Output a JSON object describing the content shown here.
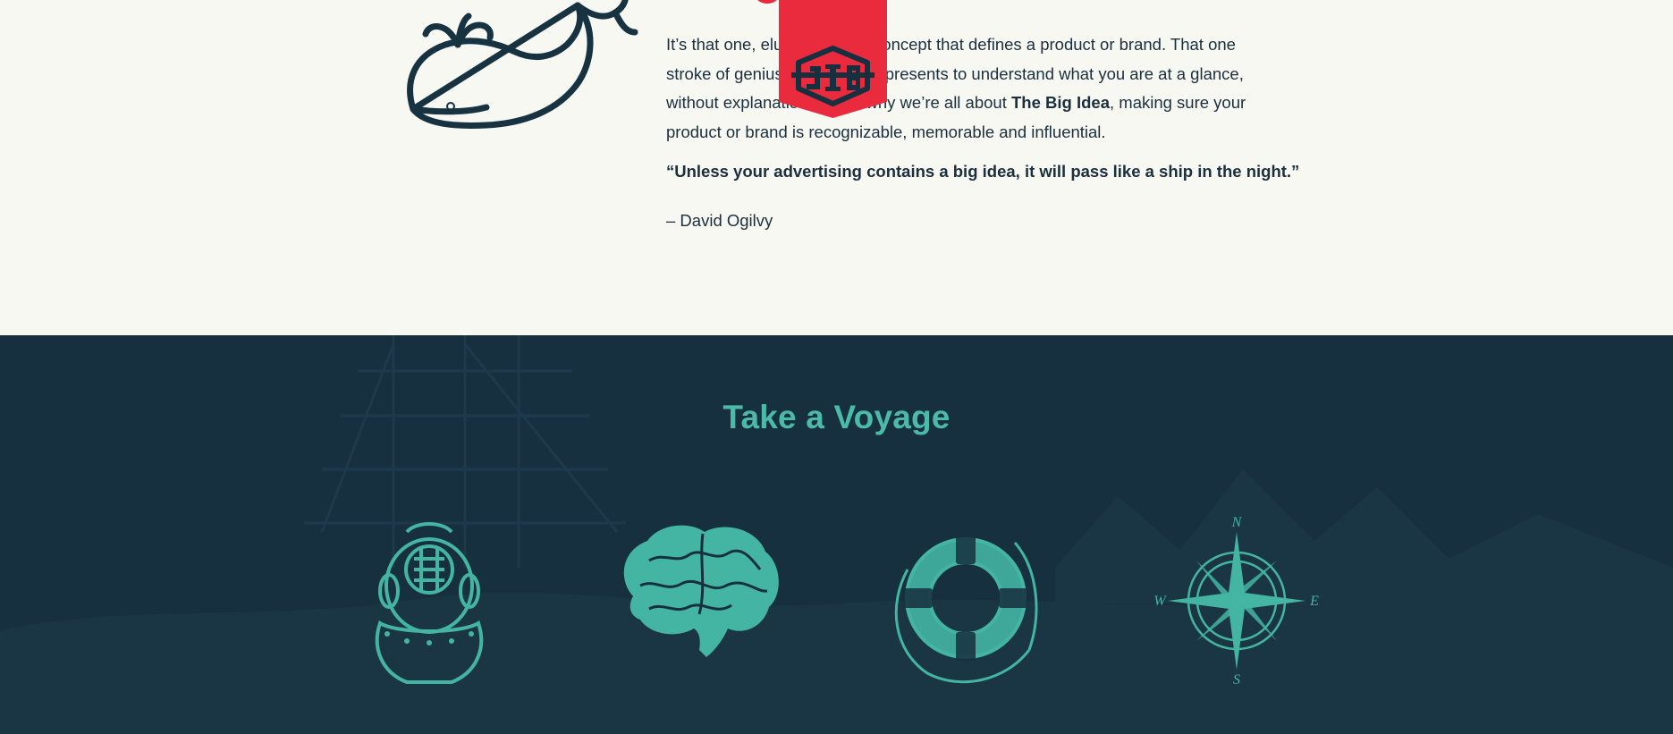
{
  "intro": {
    "p1_a": "It’s that one, elusive, simple concept that defines a product or brand. That one stroke of genius that instantly presents to understand what you are at a glance, without explanation. That’s why we’re all about ",
    "p1_bold": "The Big Idea",
    "p1_b": ", making sure your product or brand is recognizable, memorable and influential.",
    "quote": "“Unless your advertising contains a big idea, it will pass like a ship in the night.”",
    "attribution": "– David Ogilvy"
  },
  "badge": {
    "text": "JIB",
    "color": "#ea2a3d"
  },
  "voyage": {
    "title": "Take a Voyage",
    "icons": [
      {
        "name": "diving-helmet-icon"
      },
      {
        "name": "brain-icon"
      },
      {
        "name": "life-preserver-icon"
      },
      {
        "name": "compass-rose-icon",
        "n": "N",
        "e": "E",
        "s": "S",
        "w": "W"
      }
    ]
  },
  "colors": {
    "cream": "#f8f8f3",
    "navy": "#163040",
    "teal": "#4cbaa8",
    "red": "#ea2a3d",
    "text": "#1b2f3d"
  }
}
